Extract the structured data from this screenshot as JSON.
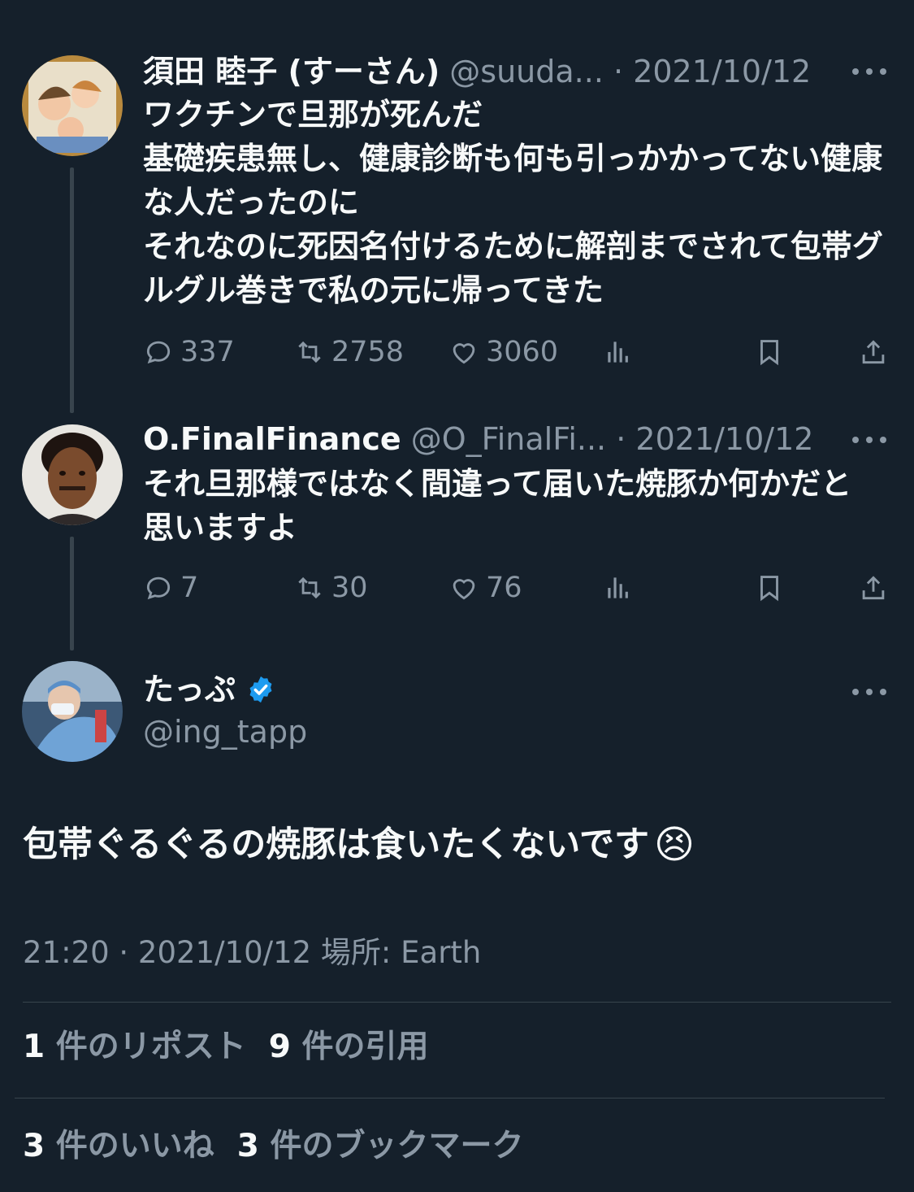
{
  "tweets": [
    {
      "name": "須田 睦子 (すーさん)",
      "handle": "@suuda...",
      "separator": "·",
      "date": "2021/10/12",
      "text": "ワクチンで旦那が死んだ\n基礎疾患無し、健康診断も何も引っかかってない健康な人だったのに\nそれなのに死因名付けるために解剖までされて包帯グルグル巻きで私の元に帰ってきた",
      "replies": "337",
      "reposts": "2758",
      "likes": "3060"
    },
    {
      "name": "O.FinalFinance",
      "handle": "@O_FinalFi...",
      "separator": "·",
      "date": "2021/10/12",
      "text": "それ旦那様ではなく間違って届いた焼豚か何かだと思いますよ",
      "replies": "7",
      "reposts": "30",
      "likes": "76"
    }
  ],
  "main": {
    "name": "たっぷ",
    "handle": "@ing_tapp",
    "text": "包帯ぐるぐるの焼豚は食いたくないです",
    "emoji": "😣",
    "meta": "21:20 · 2021/10/12  場所: Earth",
    "stats": {
      "reposts_count": "1",
      "reposts_label": "件のリポスト",
      "quotes_count": "9",
      "quotes_label": "件の引用",
      "likes_count": "3",
      "likes_label": "件のいいね",
      "bookmarks_count": "3",
      "bookmarks_label": "件のブックマーク"
    }
  },
  "colors": {
    "background": "#15202b",
    "text": "#f7f9f9",
    "secondary": "#8b98a5",
    "verified": "#1d9bf0",
    "divider": "#38444d"
  },
  "icons": [
    "reply-icon",
    "repost-icon",
    "like-icon",
    "views-icon",
    "bookmark-icon",
    "share-icon",
    "more-icon",
    "verified-badge-icon"
  ]
}
